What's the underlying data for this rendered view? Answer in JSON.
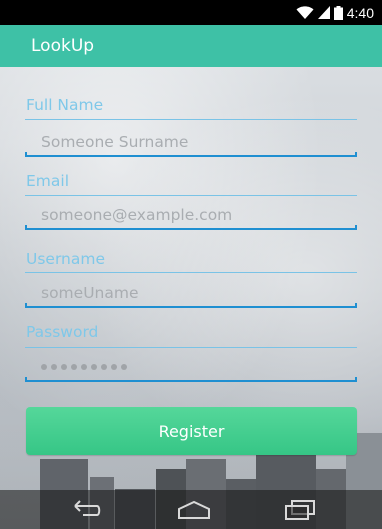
{
  "status_bar": {
    "time": "4:40",
    "wifi_icon": "wifi-icon",
    "signal_icon": "cell-signal-icon",
    "battery_icon": "battery-icon"
  },
  "app_bar": {
    "title": "LookUp",
    "color": "#3ec1a6"
  },
  "form": {
    "full_name_label": "Full Name",
    "full_name_placeholder": "Someone Surname",
    "email_label": "Email",
    "email_placeholder": "someone@example.com",
    "username_label": "Username",
    "username_placeholder": "someUname",
    "password_label": "Password",
    "password_masked_length": 9,
    "register_label": "Register"
  },
  "nav_bar": {
    "back_icon": "back-icon",
    "home_icon": "home-icon",
    "recents_icon": "recents-icon"
  },
  "colors": {
    "label": "#7fc8e9",
    "underline": "#1f8fd1",
    "button": "#3fcb8c"
  }
}
